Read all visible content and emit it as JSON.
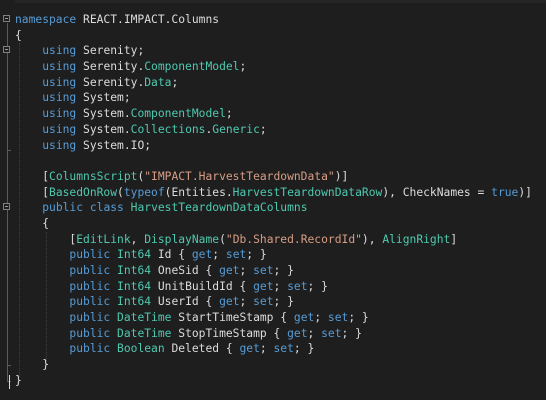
{
  "editor": {
    "colors": {
      "background": "#1e1e1e",
      "keyword": "#569cd6",
      "type": "#4ec9b0",
      "string": "#d69d85",
      "plain": "#dcdcdc"
    },
    "lines": [
      [
        {
          "t": "namespace",
          "c": "kw"
        },
        {
          "t": " REACT.IMPACT.Columns",
          "c": "pl"
        }
      ],
      [
        {
          "t": "{",
          "c": "pl"
        }
      ],
      [
        {
          "t": "    ",
          "c": "pl"
        },
        {
          "t": "using",
          "c": "kw"
        },
        {
          "t": " Serenity;",
          "c": "pl"
        }
      ],
      [
        {
          "t": "    ",
          "c": "pl"
        },
        {
          "t": "using",
          "c": "kw"
        },
        {
          "t": " Serenity.",
          "c": "pl"
        },
        {
          "t": "ComponentModel",
          "c": "ty"
        },
        {
          "t": ";",
          "c": "pl"
        }
      ],
      [
        {
          "t": "    ",
          "c": "pl"
        },
        {
          "t": "using",
          "c": "kw"
        },
        {
          "t": " Serenity.",
          "c": "pl"
        },
        {
          "t": "Data",
          "c": "ty"
        },
        {
          "t": ";",
          "c": "pl"
        }
      ],
      [
        {
          "t": "    ",
          "c": "pl"
        },
        {
          "t": "using",
          "c": "kw"
        },
        {
          "t": " System;",
          "c": "pl"
        }
      ],
      [
        {
          "t": "    ",
          "c": "pl"
        },
        {
          "t": "using",
          "c": "kw"
        },
        {
          "t": " System.",
          "c": "pl"
        },
        {
          "t": "ComponentModel",
          "c": "ty"
        },
        {
          "t": ";",
          "c": "pl"
        }
      ],
      [
        {
          "t": "    ",
          "c": "pl"
        },
        {
          "t": "using",
          "c": "kw"
        },
        {
          "t": " System.",
          "c": "pl"
        },
        {
          "t": "Collections",
          "c": "ty"
        },
        {
          "t": ".",
          "c": "pl"
        },
        {
          "t": "Generic",
          "c": "ty"
        },
        {
          "t": ";",
          "c": "pl"
        }
      ],
      [
        {
          "t": "    ",
          "c": "pl"
        },
        {
          "t": "using",
          "c": "kw"
        },
        {
          "t": " System.IO;",
          "c": "pl"
        }
      ],
      [],
      [
        {
          "t": "    [",
          "c": "pl"
        },
        {
          "t": "ColumnsScript",
          "c": "ty"
        },
        {
          "t": "(",
          "c": "pl"
        },
        {
          "t": "\"IMPACT.HarvestTeardownData\"",
          "c": "st"
        },
        {
          "t": ")]",
          "c": "pl"
        }
      ],
      [
        {
          "t": "    [",
          "c": "pl"
        },
        {
          "t": "BasedOnRow",
          "c": "ty"
        },
        {
          "t": "(",
          "c": "pl"
        },
        {
          "t": "typeof",
          "c": "kw"
        },
        {
          "t": "(Entities.",
          "c": "pl"
        },
        {
          "t": "HarvestTeardownDataRow",
          "c": "ty"
        },
        {
          "t": "), CheckNames = ",
          "c": "pl"
        },
        {
          "t": "true",
          "c": "kw"
        },
        {
          "t": ")]",
          "c": "pl"
        }
      ],
      [
        {
          "t": "    ",
          "c": "pl"
        },
        {
          "t": "public",
          "c": "kw"
        },
        {
          "t": " ",
          "c": "pl"
        },
        {
          "t": "class",
          "c": "kw"
        },
        {
          "t": " ",
          "c": "pl"
        },
        {
          "t": "HarvestTeardownDataColumns",
          "c": "ty"
        }
      ],
      [
        {
          "t": "    {",
          "c": "pl"
        }
      ],
      [
        {
          "t": "        [",
          "c": "pl"
        },
        {
          "t": "EditLink",
          "c": "ty"
        },
        {
          "t": ", ",
          "c": "pl"
        },
        {
          "t": "DisplayName",
          "c": "ty"
        },
        {
          "t": "(",
          "c": "pl"
        },
        {
          "t": "\"Db.Shared.RecordId\"",
          "c": "st"
        },
        {
          "t": "), ",
          "c": "pl"
        },
        {
          "t": "AlignRight",
          "c": "ty"
        },
        {
          "t": "]",
          "c": "pl"
        }
      ],
      [
        {
          "t": "        ",
          "c": "pl"
        },
        {
          "t": "public",
          "c": "kw"
        },
        {
          "t": " ",
          "c": "pl"
        },
        {
          "t": "Int64",
          "c": "ty"
        },
        {
          "t": " Id { ",
          "c": "pl"
        },
        {
          "t": "get",
          "c": "kw"
        },
        {
          "t": "; ",
          "c": "pl"
        },
        {
          "t": "set",
          "c": "kw"
        },
        {
          "t": "; }",
          "c": "pl"
        }
      ],
      [
        {
          "t": "        ",
          "c": "pl"
        },
        {
          "t": "public",
          "c": "kw"
        },
        {
          "t": " ",
          "c": "pl"
        },
        {
          "t": "Int64",
          "c": "ty"
        },
        {
          "t": " OneSid { ",
          "c": "pl"
        },
        {
          "t": "get",
          "c": "kw"
        },
        {
          "t": "; ",
          "c": "pl"
        },
        {
          "t": "set",
          "c": "kw"
        },
        {
          "t": "; }",
          "c": "pl"
        }
      ],
      [
        {
          "t": "        ",
          "c": "pl"
        },
        {
          "t": "public",
          "c": "kw"
        },
        {
          "t": " ",
          "c": "pl"
        },
        {
          "t": "Int64",
          "c": "ty"
        },
        {
          "t": " UnitBuildId { ",
          "c": "pl"
        },
        {
          "t": "get",
          "c": "kw"
        },
        {
          "t": "; ",
          "c": "pl"
        },
        {
          "t": "set",
          "c": "kw"
        },
        {
          "t": "; }",
          "c": "pl"
        }
      ],
      [
        {
          "t": "        ",
          "c": "pl"
        },
        {
          "t": "public",
          "c": "kw"
        },
        {
          "t": " ",
          "c": "pl"
        },
        {
          "t": "Int64",
          "c": "ty"
        },
        {
          "t": " UserId { ",
          "c": "pl"
        },
        {
          "t": "get",
          "c": "kw"
        },
        {
          "t": "; ",
          "c": "pl"
        },
        {
          "t": "set",
          "c": "kw"
        },
        {
          "t": "; }",
          "c": "pl"
        }
      ],
      [
        {
          "t": "        ",
          "c": "pl"
        },
        {
          "t": "public",
          "c": "kw"
        },
        {
          "t": " ",
          "c": "pl"
        },
        {
          "t": "DateTime",
          "c": "ty"
        },
        {
          "t": " StartTimeStamp { ",
          "c": "pl"
        },
        {
          "t": "get",
          "c": "kw"
        },
        {
          "t": "; ",
          "c": "pl"
        },
        {
          "t": "set",
          "c": "kw"
        },
        {
          "t": "; }",
          "c": "pl"
        }
      ],
      [
        {
          "t": "        ",
          "c": "pl"
        },
        {
          "t": "public",
          "c": "kw"
        },
        {
          "t": " ",
          "c": "pl"
        },
        {
          "t": "DateTime",
          "c": "ty"
        },
        {
          "t": " StopTimeStamp { ",
          "c": "pl"
        },
        {
          "t": "get",
          "c": "kw"
        },
        {
          "t": "; ",
          "c": "pl"
        },
        {
          "t": "set",
          "c": "kw"
        },
        {
          "t": "; }",
          "c": "pl"
        }
      ],
      [
        {
          "t": "        ",
          "c": "pl"
        },
        {
          "t": "public",
          "c": "kw"
        },
        {
          "t": " ",
          "c": "pl"
        },
        {
          "t": "Boolean",
          "c": "ty"
        },
        {
          "t": " Deleted { ",
          "c": "pl"
        },
        {
          "t": "get",
          "c": "kw"
        },
        {
          "t": "; ",
          "c": "pl"
        },
        {
          "t": "set",
          "c": "kw"
        },
        {
          "t": "; }",
          "c": "pl"
        }
      ],
      [
        {
          "t": "    }",
          "c": "pl"
        }
      ],
      [
        {
          "t": "}",
          "c": "pl"
        }
      ]
    ]
  }
}
